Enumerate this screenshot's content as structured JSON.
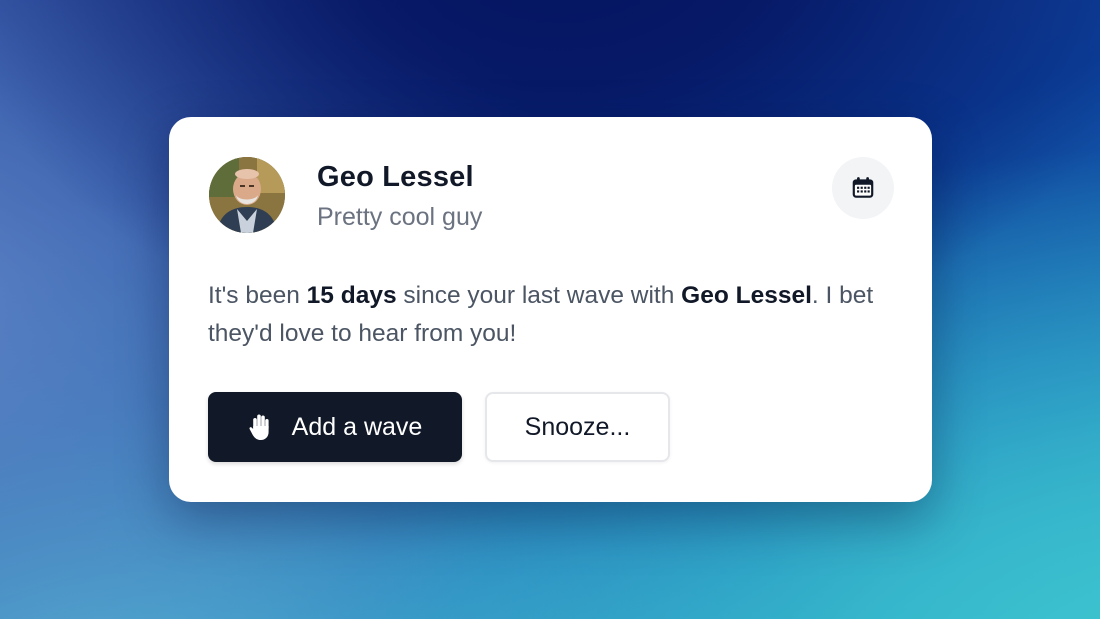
{
  "profile": {
    "name": "Geo Lessel",
    "tagline": "Pretty cool guy"
  },
  "message": {
    "prefix": "It's been ",
    "duration": "15 days",
    "middle": " since your last wave with ",
    "contact_name": "Geo Lessel",
    "suffix": ". I bet they'd love to hear from you!"
  },
  "actions": {
    "wave_label": "Add a wave",
    "snooze_label": "Snooze..."
  },
  "icons": {
    "calendar": "calendar-icon",
    "wave": "hand-wave-icon"
  },
  "colors": {
    "primary_button": "#111827",
    "card": "#ffffff",
    "muted_text": "#6b7280"
  }
}
